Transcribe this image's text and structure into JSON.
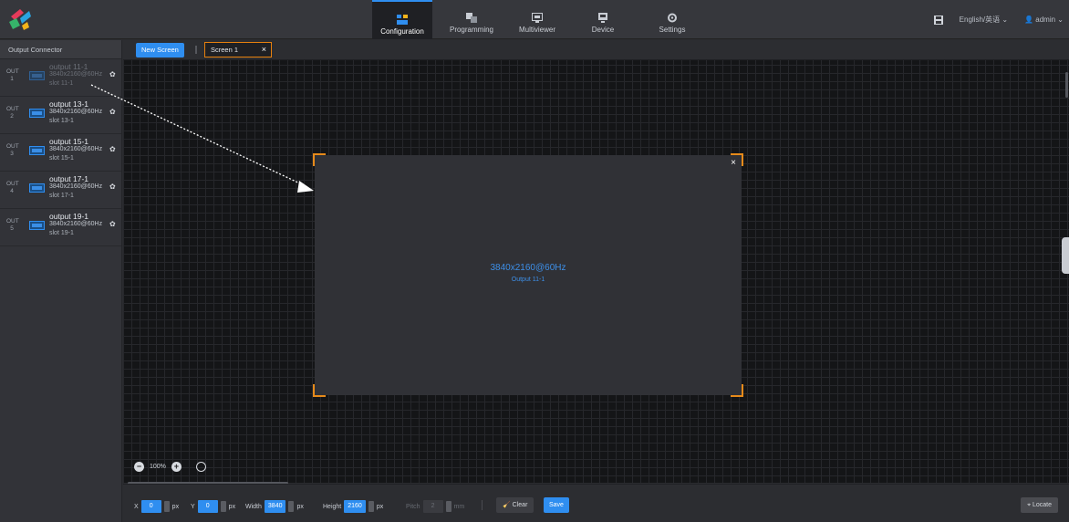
{
  "nav": {
    "tabs": [
      {
        "label": "Configuration",
        "icon": "configuration-icon",
        "active": true
      },
      {
        "label": "Programming",
        "icon": "programming-icon",
        "active": false
      },
      {
        "label": "Multiviewer",
        "icon": "multiviewer-icon",
        "active": false
      },
      {
        "label": "Device",
        "icon": "device-icon",
        "active": false
      },
      {
        "label": "Settings",
        "icon": "settings-icon",
        "active": false
      }
    ],
    "language": "English/英语",
    "user": "admin"
  },
  "left_panel": {
    "title": "Output Connector",
    "connectors": [
      {
        "out": "OUT",
        "num": "1",
        "name": "output 11-1",
        "res": "3840x2160@60Hz",
        "slot": "slot 11-1",
        "dim": true
      },
      {
        "out": "OUT",
        "num": "2",
        "name": "output 13-1",
        "res": "3840x2160@60Hz",
        "slot": "slot 13-1",
        "dim": false
      },
      {
        "out": "OUT",
        "num": "3",
        "name": "output 15-1",
        "res": "3840x2160@60Hz",
        "slot": "slot 15-1",
        "dim": false
      },
      {
        "out": "OUT",
        "num": "4",
        "name": "output 17-1",
        "res": "3840x2160@60Hz",
        "slot": "slot 17-1",
        "dim": false
      },
      {
        "out": "OUT",
        "num": "5",
        "name": "output 19-1",
        "res": "3840x2160@60Hz",
        "slot": "slot 19-1",
        "dim": false
      }
    ]
  },
  "toolbar": {
    "new_screen": "New Screen",
    "screen_tab": "Screen 1",
    "close": "×"
  },
  "screen": {
    "resolution": "3840x2160@60Hz",
    "output": "Output 11-1",
    "close": "×"
  },
  "zoom": {
    "level": "100%"
  },
  "bottom": {
    "x_label": "X",
    "x_value": "0",
    "x_unit": "px",
    "y_label": "Y",
    "y_value": "0",
    "y_unit": "px",
    "width_label": "Width",
    "width_value": "3840",
    "width_unit": "px",
    "height_label": "Height",
    "height_value": "2160",
    "height_unit": "px",
    "pitch_label": "Pitch",
    "pitch_value": "2",
    "pitch_unit": "mm",
    "clear": "Clear",
    "save": "Save",
    "locate": "Locate"
  },
  "colors": {
    "accent": "#2f8ef0",
    "highlight": "#e68a1a"
  }
}
